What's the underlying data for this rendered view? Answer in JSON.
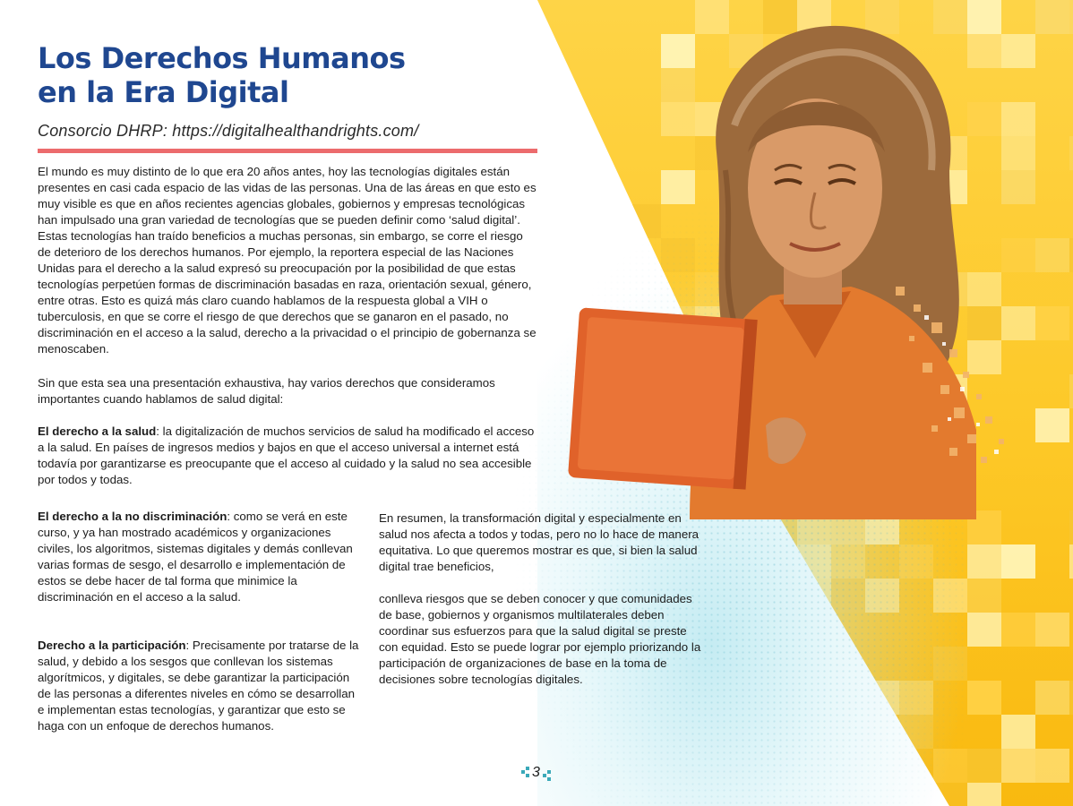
{
  "header": {
    "title_line1": "Los Derechos Humanos",
    "title_line2": "en la Era Digital",
    "subtitle": "Consorcio DHRP: https://digitalhealthandrights.com/"
  },
  "body": {
    "intro": "El mundo es muy distinto de lo que era 20 años antes, hoy las tecnologías digitales están presentes en casi cada espacio de las vidas de las personas. Una de las áreas en que esto es muy visible es que en años recientes agencias globales, gobiernos y empresas tecnológicas han impulsado una gran variedad de tecnologías que se pueden definir como ‘salud digital’. Estas tecnologías han traído beneficios a muchas personas, sin embargo, se corre el riesgo de deterioro de los derechos humanos. Por ejemplo, la reportera especial de las Naciones Unidas para el derecho a la salud expresó su preocupación por la posibilidad de que estas tecnologías perpetúen formas de discriminación basadas en raza, orientación sexual, género, entre otras. Esto es quizá más claro cuando hablamos de la respuesta global a VIH o tuberculosis, en que se corre el riesgo de que derechos que se ganaron en el pasado, no discriminación en el acceso a la salud, derecho a la privacidad o el principio de gobernanza se menoscaben.",
    "intro2": "Sin que esta sea una presentación exhaustiva, hay varios derechos que consideramos importantes cuando hablamos de salud digital:",
    "salud_heading": "El derecho a la salud",
    "salud_text": ": la digitalización de muchos servicios de salud ha modificado el acceso a la salud. En países de ingresos medios y bajos en que el acceso universal a internet está todavía por garantizarse es preocupante que el acceso al cuidado y la salud no sea accesible por todos y todas.",
    "nodisc_heading": "El derecho a la no discriminación",
    "nodisc_text": ": como se verá en este curso, y ya han mostrado académicos y organizaciones civiles, los algoritmos, sistemas digitales y demás conllevan varias formas de sesgo, el desarrollo e implementación de estos se debe hacer de tal forma que minimice la discriminación en el acceso a la salud.",
    "partic_heading": "Derecho a la participación",
    "partic_text": ": Precisamente por tratarse de la salud, y debido a los sesgos que conllevan los sistemas algorítmicos, y digitales, se debe garantizar la participación de las personas a diferentes niveles en cómo se desarrollan e implementan estas tecnologías, y garantizar que esto se haga con un enfoque de derechos humanos.",
    "resumen1": "En resumen, la transformación digital y especialmente en salud nos afecta a todos y todas, pero no lo hace de manera equitativa. Lo que queremos mostrar es que, si bien la salud digital trae beneficios,",
    "resumen2": "conlleva riesgos que se deben conocer y que comunidades de base, gobiernos y organismos multilaterales deben coordinar sus esfuerzos para que la salud digital se preste con equidad. Esto se puede lograr por ejemplo priorizando la participación de organizaciones de base en la toma de decisiones sobre tecnologías digitales."
  },
  "footer": {
    "page_number": "3"
  },
  "colors": {
    "title": "#1f4790",
    "rule": "#ec6b6d",
    "yellow": "#fdc827",
    "teal": "#3aa9b9",
    "laptop": "#e0622a"
  },
  "icons": {
    "illustration": "woman-with-laptop-illustration",
    "page_marker": "pixel-squares-icon"
  }
}
